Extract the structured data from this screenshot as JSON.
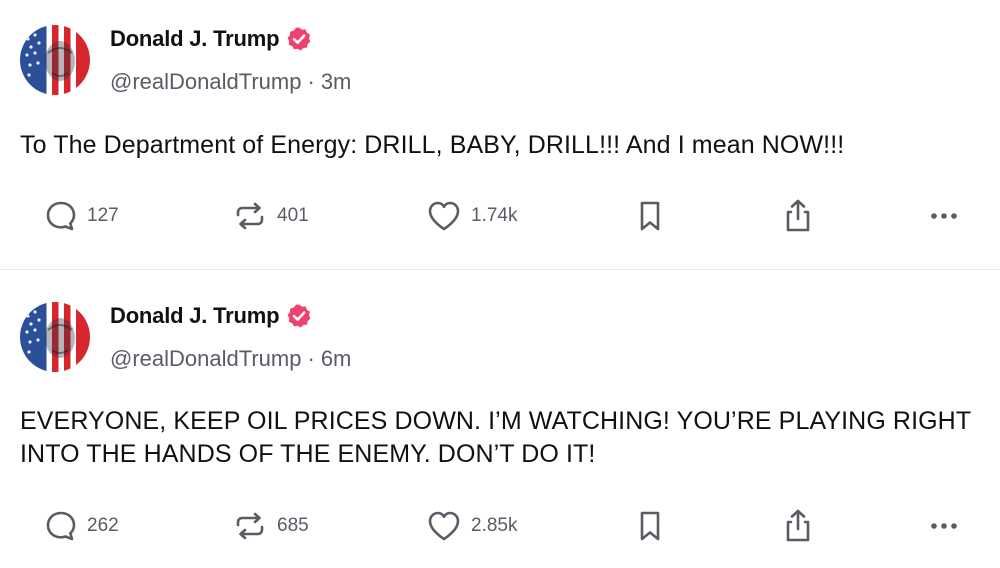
{
  "posts": [
    {
      "author": "Donald J. Trump",
      "handle": "@realDonaldTrump",
      "separator": "·",
      "time": "3m",
      "text": "To The Department of Energy: DRILL, BABY, DRILL!!!  And I mean NOW!!!",
      "replies": "127",
      "reposts": "401",
      "likes": "1.74k"
    },
    {
      "author": "Donald J. Trump",
      "handle": "@realDonaldTrump",
      "separator": "·",
      "time": "6m",
      "text": "EVERYONE, KEEP OIL PRICES DOWN. I’M WATCHING! YOU’RE PLAYING RIGHT INTO THE HANDS OF THE ENEMY. DON’T DO IT!",
      "replies": "262",
      "reposts": "685",
      "likes": "2.85k"
    }
  ],
  "icons": {
    "verified": "verified-badge-icon",
    "reply": "reply-icon",
    "repost": "repost-icon",
    "like": "heart-icon",
    "bookmark": "bookmark-icon",
    "share": "share-icon",
    "more": "more-icon"
  },
  "colors": {
    "verified_badge": "#f0426f",
    "text": "#111111",
    "secondary_text": "#5b5b66",
    "divider": "#e9e9ef"
  }
}
